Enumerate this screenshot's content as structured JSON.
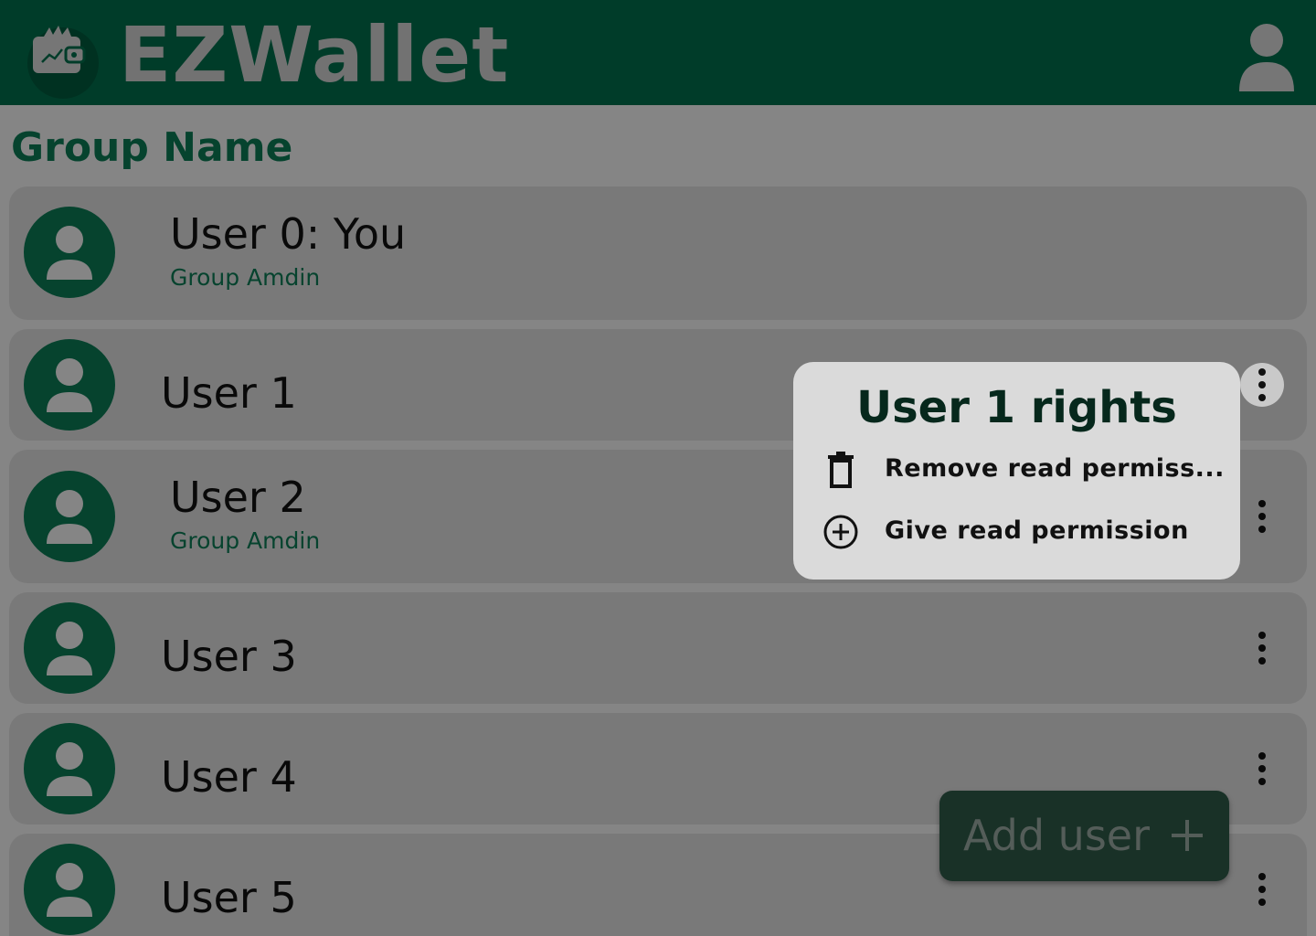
{
  "app": {
    "title": "EZWallet"
  },
  "header": {
    "logo_icon": "wallet-icon",
    "account_icon": "user-icon"
  },
  "page": {
    "group_name": "Group Name"
  },
  "users": [
    {
      "name": "User 0: You",
      "role": "Group Amdin"
    },
    {
      "name": "User 1",
      "role": ""
    },
    {
      "name": "User 2",
      "role": "Group Amdin"
    },
    {
      "name": "User 3",
      "role": ""
    },
    {
      "name": "User 4",
      "role": ""
    },
    {
      "name": "User 5",
      "role": ""
    }
  ],
  "popup": {
    "title": "User 1 rights",
    "items": [
      {
        "label": "Remove read permiss...",
        "icon": "trash-icon"
      },
      {
        "label": "Give read permission",
        "icon": "plus-circle-icon"
      }
    ]
  },
  "fab": {
    "label": "Add user",
    "icon": "plus-icon"
  },
  "colors": {
    "header_bg": "#006e4c",
    "accent_green": "#0b7a55",
    "row_bg": "#dcdcdc",
    "popup_bg": "#dadada",
    "fab_bg": "#2f5a48"
  }
}
